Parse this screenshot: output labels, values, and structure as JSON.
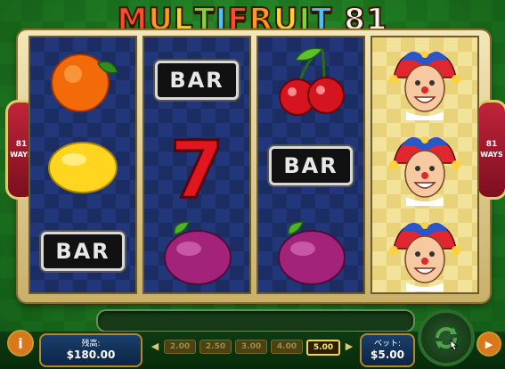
{
  "title": {
    "text": "MULTIFRUIT 81",
    "letters": [
      {
        "ch": "M",
        "color": "#ff4b2e"
      },
      {
        "ch": "U",
        "color": "#ff9a1e"
      },
      {
        "ch": "L",
        "color": "#ffd02a"
      },
      {
        "ch": "T",
        "color": "#7bd832"
      },
      {
        "ch": "I",
        "color": "#43c7ff"
      },
      {
        "ch": "F",
        "color": "#ff4b2e"
      },
      {
        "ch": "R",
        "color": "#ff9a1e"
      },
      {
        "ch": "U",
        "color": "#ffd02a"
      },
      {
        "ch": "I",
        "color": "#7bd832"
      },
      {
        "ch": "T",
        "color": "#43c7ff"
      },
      {
        "ch": " ",
        "color": "#ffffff"
      },
      {
        "ch": "8",
        "color": "#f4f4f4"
      },
      {
        "ch": "1",
        "color": "#f4f4f4"
      }
    ]
  },
  "ways": {
    "number": "81",
    "label": "WAYS"
  },
  "reels": [
    [
      "orange",
      "lemon",
      "BAR"
    ],
    [
      "BAR",
      "seven",
      "plum"
    ],
    [
      "cherries",
      "BAR",
      "plum"
    ],
    [
      "jester",
      "jester",
      "jester"
    ]
  ],
  "bar_label": "BAR",
  "controls": {
    "info": "i",
    "balance_label": "残高:",
    "balance_value": "$180.00",
    "bet_options": [
      "2.00",
      "2.50",
      "3.00",
      "4.00",
      "5.00"
    ],
    "selected_bet": "5.00",
    "bet_label": "ベット:",
    "bet_value": "$5.00",
    "autoplay": "▶"
  }
}
